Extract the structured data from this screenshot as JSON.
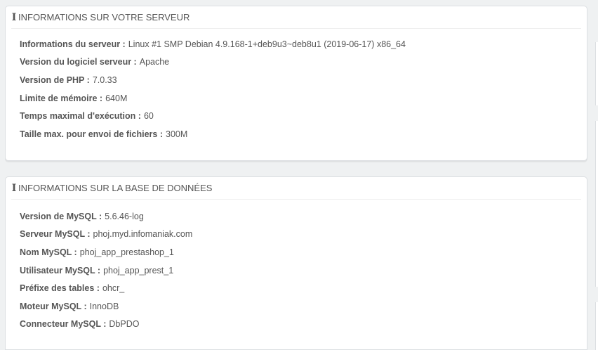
{
  "server_panel": {
    "title": "INFORMATIONS SUR VOTRE SERVEUR",
    "rows": [
      {
        "label": "Informations du serveur :",
        "value": "Linux #1 SMP Debian 4.9.168-1+deb9u3~deb8u1 (2019-06-17) x86_64"
      },
      {
        "label": "Version du logiciel serveur :",
        "value": "Apache"
      },
      {
        "label": "Version de PHP :",
        "value": "7.0.33"
      },
      {
        "label": "Limite de mémoire :",
        "value": "640M"
      },
      {
        "label": "Temps maximal d'exécution :",
        "value": "60"
      },
      {
        "label": "Taille max. pour envoi de fichiers :",
        "value": "300M"
      }
    ]
  },
  "database_panel": {
    "title": "INFORMATIONS SUR LA BASE DE DONNÉES",
    "rows": [
      {
        "label": "Version de MySQL :",
        "value": "5.6.46-log"
      },
      {
        "label": "Serveur MySQL :",
        "value": "phoj.myd.infomaniak.com"
      },
      {
        "label": "Nom MySQL :",
        "value": "phoj_app_prestashop_1"
      },
      {
        "label": "Utilisateur MySQL :",
        "value": "phoj_app_prest_1"
      },
      {
        "label": "Préfixe des tables :",
        "value": "ohcr_"
      },
      {
        "label": "Moteur MySQL :",
        "value": "InnoDB"
      },
      {
        "label": "Connecteur MySQL :",
        "value": "DbPDO"
      }
    ]
  },
  "icons": {
    "panel_heading_icon": "info-icon"
  }
}
